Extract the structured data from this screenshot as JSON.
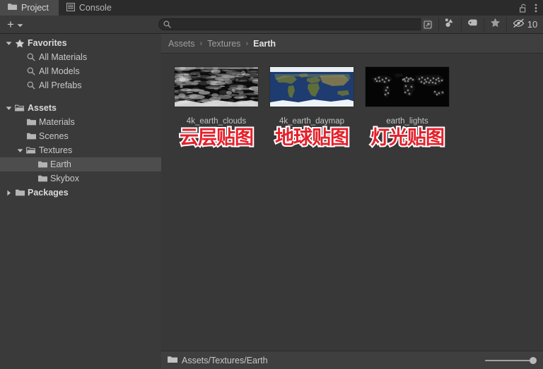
{
  "window": {
    "tabs": [
      {
        "label": "Project",
        "icon": "folder-icon",
        "active": true
      },
      {
        "label": "Console",
        "icon": "list-icon",
        "active": false
      }
    ],
    "lock_icon": "padlock-open-icon",
    "menu_icon": "kebab-menu-icon"
  },
  "toolbar": {
    "add_label": "+",
    "add_dropdown_icon": "chevron-down-icon",
    "search": {
      "value": "",
      "placeholder": "",
      "icon": "search-icon"
    },
    "search_expand_icon": "open-in-search-window-icon",
    "filters": [
      {
        "name": "filter-by-type",
        "icon": "shapes-icon"
      },
      {
        "name": "filter-by-label",
        "icon": "tag-icon"
      },
      {
        "name": "filter-by-favorite",
        "icon": "star-icon"
      }
    ],
    "hidden_items": {
      "icon": "eye-slash-icon",
      "count": "10"
    }
  },
  "sidebar": {
    "items": [
      {
        "label": "Favorites",
        "icon": "star-icon",
        "arrow": "expanded",
        "depth": 0,
        "bold": true,
        "selected": false
      },
      {
        "label": "All Materials",
        "icon": "search-icon",
        "arrow": "none",
        "depth": 1,
        "bold": false,
        "selected": false
      },
      {
        "label": "All Models",
        "icon": "search-icon",
        "arrow": "none",
        "depth": 1,
        "bold": false,
        "selected": false
      },
      {
        "label": "All Prefabs",
        "icon": "search-icon",
        "arrow": "none",
        "depth": 1,
        "bold": false,
        "selected": false
      },
      {
        "label": "Assets",
        "icon": "folder-open-icon",
        "arrow": "expanded",
        "depth": 0,
        "bold": true,
        "selected": false
      },
      {
        "label": "Materials",
        "icon": "folder-icon",
        "arrow": "none",
        "depth": 1,
        "bold": false,
        "selected": false
      },
      {
        "label": "Scenes",
        "icon": "folder-icon",
        "arrow": "none",
        "depth": 1,
        "bold": false,
        "selected": false
      },
      {
        "label": "Textures",
        "icon": "folder-open-icon",
        "arrow": "expanded",
        "depth": 1,
        "bold": false,
        "selected": false
      },
      {
        "label": "Earth",
        "icon": "folder-icon",
        "arrow": "none",
        "depth": 2,
        "bold": false,
        "selected": true
      },
      {
        "label": "Skybox",
        "icon": "folder-icon",
        "arrow": "none",
        "depth": 2,
        "bold": false,
        "selected": false
      },
      {
        "label": "Packages",
        "icon": "folder-icon",
        "arrow": "collapsed",
        "depth": 0,
        "bold": true,
        "selected": false
      }
    ]
  },
  "breadcrumb": {
    "crumbs": [
      "Assets",
      "Textures",
      "Earth"
    ],
    "separator": "›"
  },
  "assets": [
    {
      "name": "4k_earth_clouds",
      "annotation": "云层贴图",
      "thumb": "clouds-texture"
    },
    {
      "name": "4k_earth_daymap",
      "annotation": "地球贴图",
      "thumb": "daymap-texture"
    },
    {
      "name": "earth_lights",
      "annotation": "灯光贴图",
      "thumb": "lights-texture"
    }
  ],
  "statusbar": {
    "path": "Assets/Textures/Earth",
    "folder_icon": "folder-icon",
    "zoom_value": "100"
  },
  "colors": {
    "panel_bg": "#3a3a3a",
    "tabbar_bg": "#2b2b2b",
    "active_tab_bg": "#4a4a4a",
    "selection": "#4d4d4d",
    "text": "#c9c9c9",
    "annotation_red": "#e5202b",
    "annotation_outline": "#ffffff",
    "ocean_blue": "#1e3c70"
  }
}
